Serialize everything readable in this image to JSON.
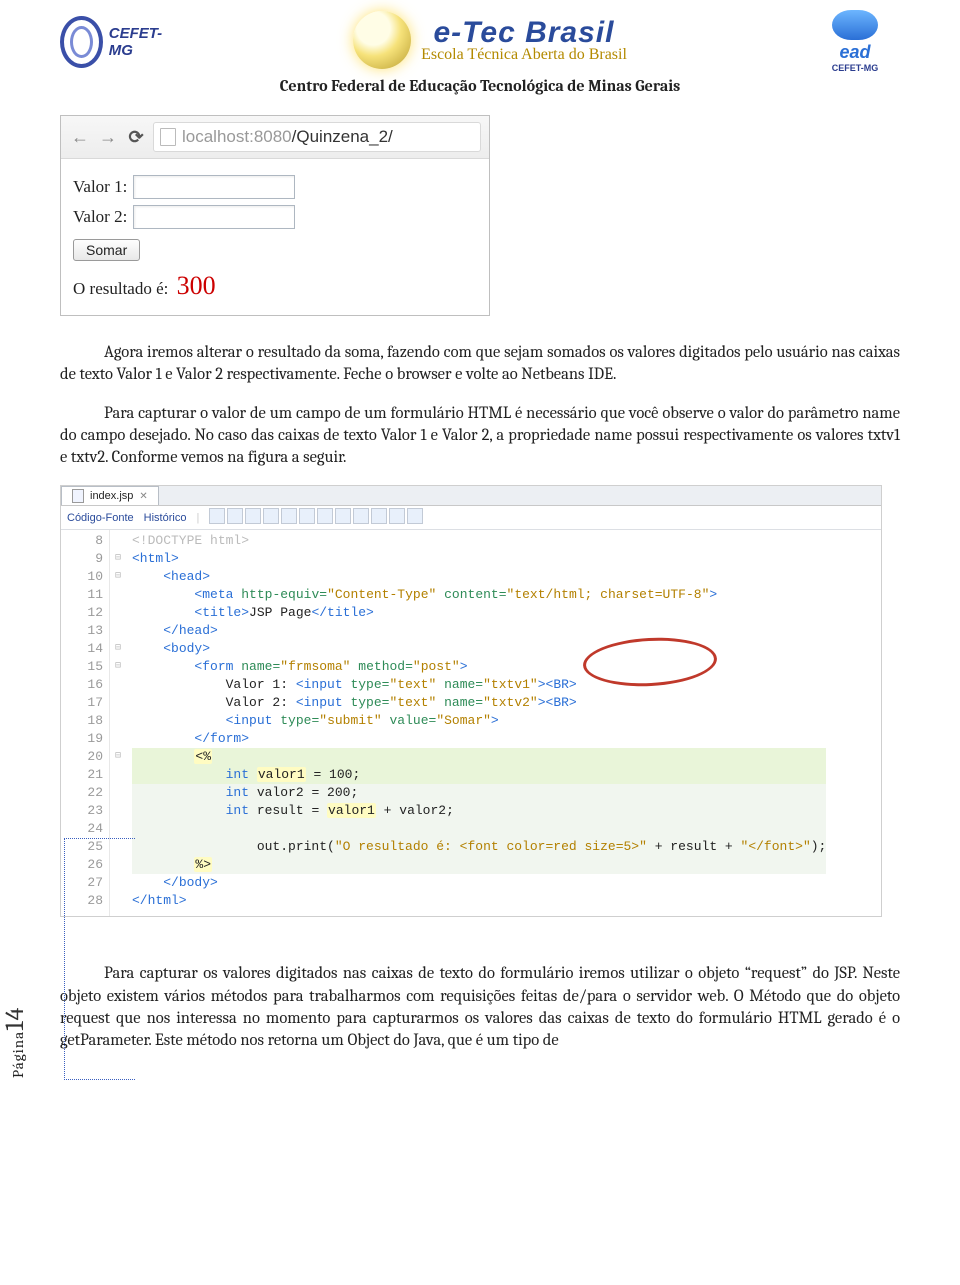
{
  "header": {
    "cefet_text": "CEFET-MG",
    "etec_main": "e-Tec Brasil",
    "etec_sub": "Escola Técnica Aberta do Brasil",
    "ead_text": "ead",
    "ead_sub": "CEFET-MG",
    "center_title": "Centro Federal de Educação Tecnológica de Minas Gerais"
  },
  "browser": {
    "url_host": "localhost:8080",
    "url_path": "/Quinzena_2/",
    "label_v1": "Valor 1:",
    "label_v2": "Valor 2:",
    "btn": "Somar",
    "resultado_label": "O resultado é:",
    "resultado_val": "300"
  },
  "para1": "Agora iremos alterar o resultado da soma, fazendo com que sejam somados os valores digitados pelo usuário nas caixas de texto Valor 1 e Valor 2 respectivamente. Feche o browser e volte ao Netbeans IDE.",
  "para2": "Para capturar o valor de um campo de um formulário HTML é necessário que você observe o valor do parâmetro name do campo desejado. No caso das caixas de texto Valor 1 e Valor 2, a propriedade name possui respectivamente os valores txtv1 e txtv2. Conforme vemos na figura a seguir.",
  "ide": {
    "tab": "index.jsp",
    "sub_left": "Código-Fonte",
    "sub_right": "Histórico",
    "lines": [
      {
        "n": 8,
        "f": "",
        "cls": "",
        "html": "<span class='cmt'>&lt;!DOCTYPE html&gt;</span>"
      },
      {
        "n": 9,
        "f": "⊟",
        "cls": "",
        "html": "<span class='tag'>&lt;html&gt;</span>"
      },
      {
        "n": 10,
        "f": "⊟",
        "cls": "",
        "html": "    <span class='tag'>&lt;head&gt;</span>"
      },
      {
        "n": 11,
        "f": "",
        "cls": "",
        "html": "        <span class='tag'>&lt;meta</span> <span class='attr'>http-equiv=</span><span class='str'>\"Content-Type\"</span> <span class='attr'>content=</span><span class='str'>\"text/html; charset=UTF-8\"</span><span class='tag'>&gt;</span>"
      },
      {
        "n": 12,
        "f": "",
        "cls": "",
        "html": "        <span class='tag'>&lt;title&gt;</span>JSP Page<span class='tag'>&lt;/title&gt;</span>"
      },
      {
        "n": 13,
        "f": "",
        "cls": "",
        "html": "    <span class='tag'>&lt;/head&gt;</span>"
      },
      {
        "n": 14,
        "f": "⊟",
        "cls": "",
        "html": "    <span class='tag'>&lt;body&gt;</span>"
      },
      {
        "n": 15,
        "f": "⊟",
        "cls": "",
        "html": "        <span class='tag'>&lt;form</span> <span class='attr'>name=</span><span class='str'>\"frmsoma\"</span> <span class='attr'>method=</span><span class='str'>\"post\"</span><span class='tag'>&gt;</span>"
      },
      {
        "n": 16,
        "f": "",
        "cls": "",
        "html": "            Valor 1: <span class='tag'>&lt;input</span> <span class='attr'>type=</span><span class='str'>\"text\"</span> <span class='attr'>name=</span><span class='str'>\"txtv1\"</span><span class='tag'>&gt;&lt;BR&gt;</span>"
      },
      {
        "n": 17,
        "f": "",
        "cls": "",
        "html": "            Valor 2: <span class='tag'>&lt;input</span> <span class='attr'>type=</span><span class='str'>\"text\"</span> <span class='attr'>name=</span><span class='str'>\"txtv2\"</span><span class='tag'>&gt;&lt;BR&gt;</span>"
      },
      {
        "n": 18,
        "f": "",
        "cls": "",
        "html": "            <span class='tag'>&lt;input</span> <span class='attr'>type=</span><span class='str'>\"submit\"</span> <span class='attr'>value=</span><span class='str'>\"Somar\"</span><span class='tag'>&gt;</span>"
      },
      {
        "n": 19,
        "f": "",
        "cls": "",
        "html": "        <span class='tag'>&lt;/form&gt;</span>"
      },
      {
        "n": 20,
        "f": "⊟",
        "cls": "scriptlet-bg hl",
        "html": "        <span class='hlY'>&lt;%</span>"
      },
      {
        "n": 21,
        "f": "",
        "cls": "scriptlet-bg hl",
        "html": "            <span class='kw'>int</span> <span class='hlY'>valor1</span> = 100;"
      },
      {
        "n": 22,
        "f": "",
        "cls": "scriptlet-bg",
        "html": "            <span class='kw'>int</span> valor2 = 200;"
      },
      {
        "n": 23,
        "f": "",
        "cls": "scriptlet-bg",
        "html": "            <span class='kw'>int</span> result = <span class='hlY'>valor1</span> + valor2;"
      },
      {
        "n": 24,
        "f": "",
        "cls": "scriptlet-bg",
        "html": ""
      },
      {
        "n": 25,
        "f": "",
        "cls": "scriptlet-bg",
        "html": "                out.print(<span class='str'>\"O resultado é: &lt;font color=red size=5&gt;\"</span> + result + <span class='str'>\"&lt;/font&gt;\"</span>);"
      },
      {
        "n": 26,
        "f": "",
        "cls": "scriptlet-bg",
        "html": "        <span class='hlY'>%&gt;</span>"
      },
      {
        "n": 27,
        "f": "",
        "cls": "",
        "html": "    <span class='tag'>&lt;/body&gt;</span>"
      },
      {
        "n": 28,
        "f": "",
        "cls": "",
        "html": "<span class='tag'>&lt;/html&gt;</span>"
      }
    ]
  },
  "para3": "Para capturar os valores digitados nas caixas de texto do formulário iremos utilizar o objeto “request” do JSP. Neste objeto existem vários métodos para trabalharmos com requisições feitas de/para o servidor web. O Método que do objeto request que nos interessa no momento para capturarmos os valores das caixas de texto do formulário HTML gerado é o getParameter. Este método nos retorna um Object do Java, que é um tipo de",
  "pagenum_label": "Página",
  "pagenum_val": "14"
}
